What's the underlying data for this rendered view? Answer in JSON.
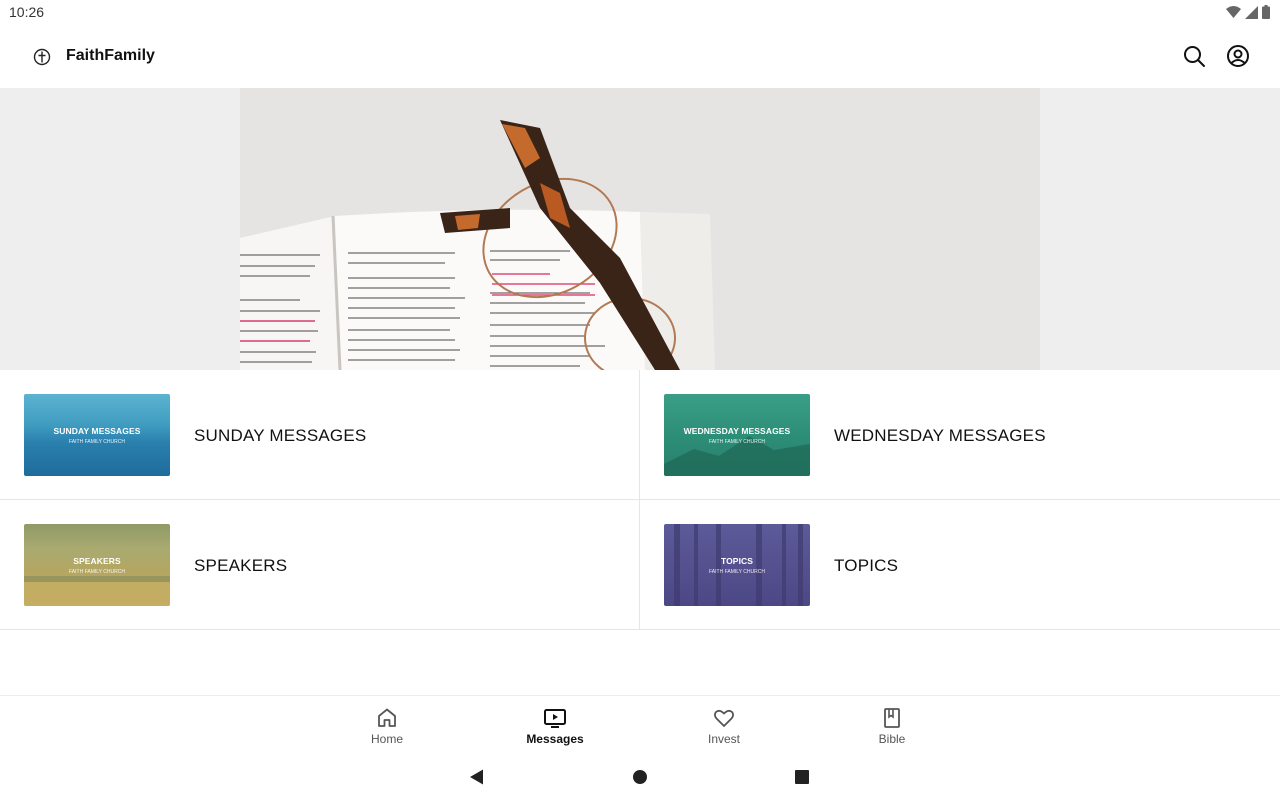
{
  "status_bar": {
    "time": "10:26",
    "icons": [
      "wifi-icon",
      "signal-icon",
      "battery-icon"
    ]
  },
  "app_bar": {
    "title": "FaithFamily",
    "logo_icon": "cross-circle-icon",
    "actions": [
      "search-icon",
      "account-icon"
    ]
  },
  "hero": {
    "image": "open-bible-with-glasses"
  },
  "categories": [
    {
      "label": "SUNDAY MESSAGES",
      "thumb_title": "SUNDAY MESSAGES",
      "thumb_sub": "FAITH FAMILY CHURCH",
      "color": "#3f9cc0"
    },
    {
      "label": "WEDNESDAY MESSAGES",
      "thumb_title": "WEDNESDAY MESSAGES",
      "thumb_sub": "FAITH FAMILY CHURCH",
      "color": "#2c8d76"
    },
    {
      "label": "SPEAKERS",
      "thumb_title": "SPEAKERS",
      "thumb_sub": "FAITH FAMILY CHURCH",
      "color": "#b5a661"
    },
    {
      "label": "TOPICS",
      "thumb_title": "TOPICS",
      "thumb_sub": "FAITH FAMILY CHURCH",
      "color": "#544f8d"
    }
  ],
  "bottom_nav": {
    "items": [
      {
        "label": "Home",
        "icon": "home-icon"
      },
      {
        "label": "Messages",
        "icon": "video-play-icon",
        "active": true
      },
      {
        "label": "Invest",
        "icon": "heart-icon"
      },
      {
        "label": "Bible",
        "icon": "bookmark-book-icon"
      }
    ]
  },
  "system_nav": [
    "back-triangle-icon",
    "home-circle-icon",
    "recents-square-icon"
  ]
}
